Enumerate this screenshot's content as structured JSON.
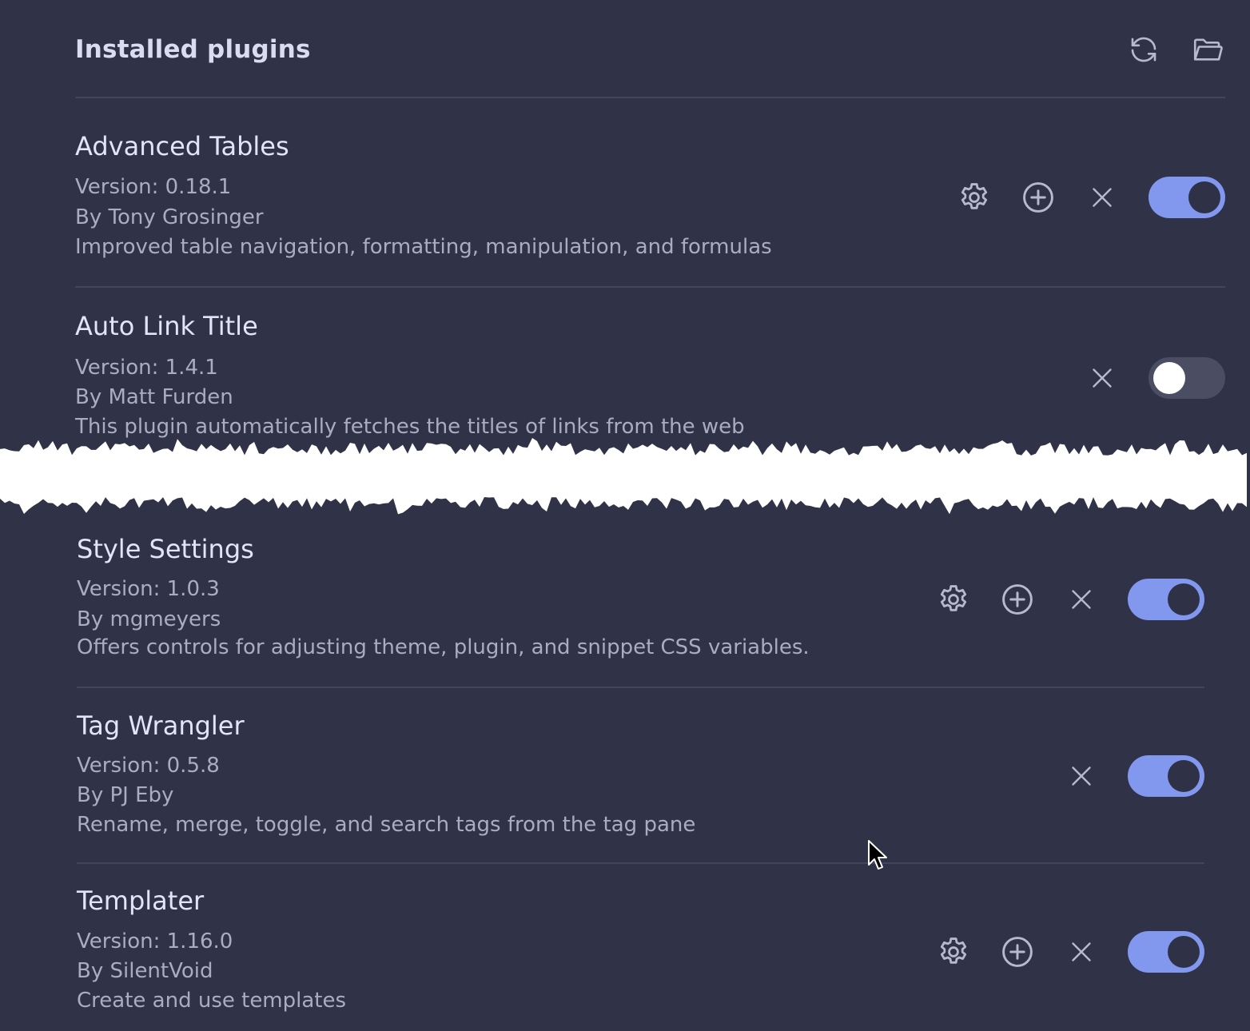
{
  "header": {
    "title": "Installed plugins",
    "actions": [
      {
        "icon": "refresh-icon"
      },
      {
        "icon": "folder-open-icon"
      }
    ]
  },
  "colors": {
    "background": "#303347",
    "toggle_on": "#8198ee",
    "toggle_off": "#4b4e62",
    "divider": "#42465b",
    "title_text": "#e2e4f7",
    "meta_text": "#a9acc3"
  },
  "plugins": [
    {
      "name": "Advanced Tables",
      "version": "Version: 0.18.1",
      "author": "By Tony Grosinger",
      "description": "Improved table navigation, formatting, manipulation, and formulas",
      "has_settings": true,
      "has_hotkeys": true,
      "enabled": true
    },
    {
      "name": "Auto Link Title",
      "version": "Version: 1.4.1",
      "author": "By Matt Furden",
      "description": "This plugin automatically fetches the titles of links from the web",
      "has_settings": false,
      "has_hotkeys": false,
      "enabled": false
    },
    {
      "name": "Style Settings",
      "version": "Version: 1.0.3",
      "author": "By mgmeyers",
      "description": "Offers controls for adjusting theme, plugin, and snippet CSS variables.",
      "has_settings": true,
      "has_hotkeys": true,
      "enabled": true
    },
    {
      "name": "Tag Wrangler",
      "version": "Version: 0.5.8",
      "author": "By PJ Eby",
      "description": "Rename, merge, toggle, and search tags from the tag pane",
      "has_settings": false,
      "has_hotkeys": false,
      "enabled": true
    },
    {
      "name": "Templater",
      "version": "Version: 1.16.0",
      "author": "By SilentVoid",
      "description": "Create and use templates",
      "has_settings": true,
      "has_hotkeys": true,
      "enabled": true
    }
  ]
}
